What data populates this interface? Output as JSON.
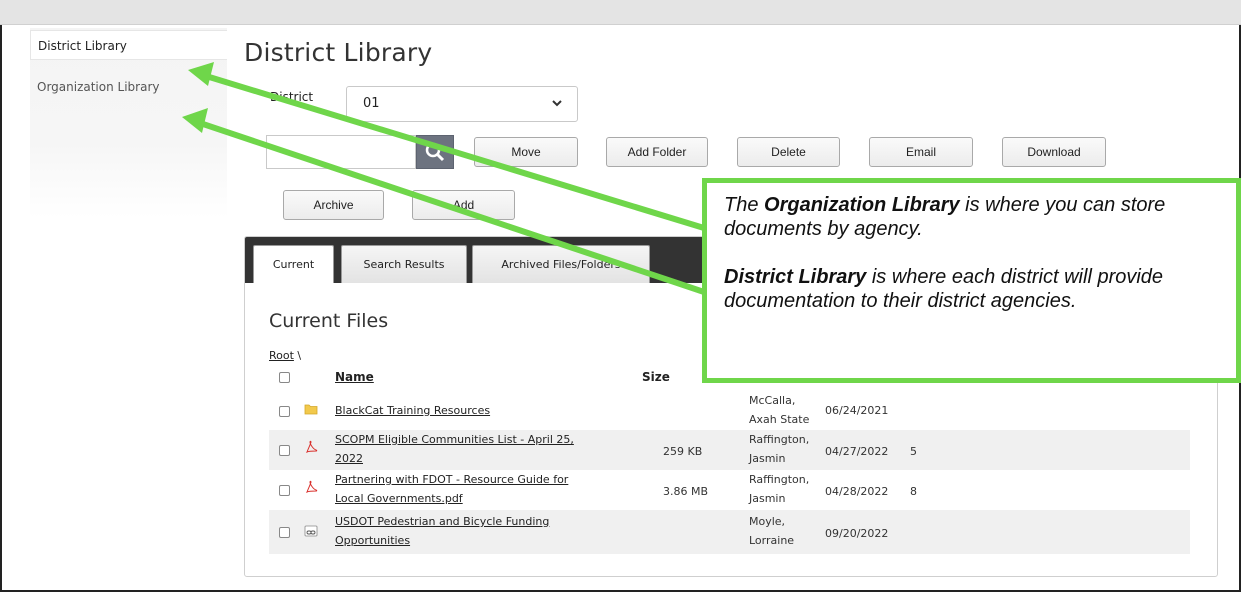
{
  "nav": {
    "items": [
      {
        "label": "District Library"
      },
      {
        "label": "Organization Library"
      }
    ]
  },
  "page_title": "District Library",
  "district": {
    "label": "District",
    "value": "01"
  },
  "buttons": {
    "move": "Move",
    "add_folder": "Add Folder",
    "delete": "Delete",
    "email": "Email",
    "download": "Download",
    "archive": "Archive",
    "add": "Add"
  },
  "tabs": [
    {
      "label": "Current"
    },
    {
      "label": "Search Results"
    },
    {
      "label": "Archived Files/Folders"
    }
  ],
  "section_title": "Current Files",
  "breadcrumb": {
    "root": "Root",
    "sep": "\\"
  },
  "table": {
    "headers": {
      "name": "Name",
      "size": "Size"
    },
    "rows": [
      {
        "icon": "folder-icon",
        "name": "BlackCat Training Resources",
        "size": "",
        "owner_line1": "McCalla,",
        "owner_line2": "Axah State",
        "date": "06/24/2021",
        "count": ""
      },
      {
        "icon": "pdf-icon",
        "name_line1": "SCOPM Eligible Communities List - April 25,",
        "name_line2": "2022",
        "size": "259 KB",
        "owner_line1": "Raffington,",
        "owner_line2": "Jasmin",
        "date": "04/27/2022",
        "count": "5"
      },
      {
        "icon": "pdf-icon",
        "name_line1": "Partnering with FDOT - Resource Guide for",
        "name_line2": "Local Governments.pdf",
        "size": "3.86 MB",
        "owner_line1": "Raffington,",
        "owner_line2": "Jasmin",
        "date": "04/28/2022",
        "count": "8"
      },
      {
        "icon": "link-icon",
        "name_line1": "USDOT Pedestrian and Bicycle Funding",
        "name_line2": "Opportunities",
        "size": "",
        "owner_line1": "Moyle,",
        "owner_line2": "Lorraine",
        "date": "09/20/2022",
        "count": ""
      }
    ]
  },
  "callout": {
    "p1_prefix": "The ",
    "p1_bold": "Organization Library",
    "p1_suffix": " is where you can store documents by agency.",
    "p2_bold": "District Library",
    "p2_suffix": " is where each district will provide documentation to their district agencies."
  },
  "colors": {
    "accent_green": "#6fd64a",
    "tabbar": "#333333"
  }
}
